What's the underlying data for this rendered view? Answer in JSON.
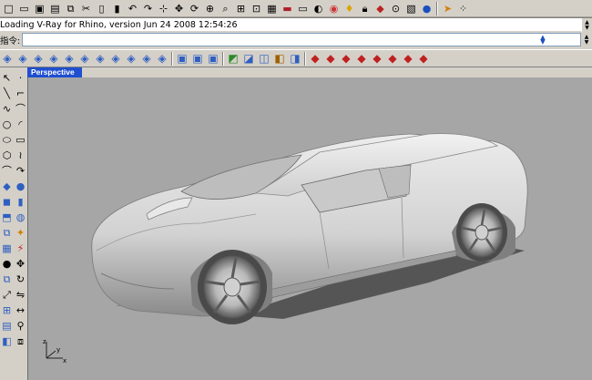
{
  "history": {
    "text": "Loading V-Ray for Rhino, version Jun 24 2008  12:54:26"
  },
  "command": {
    "label": "指令:",
    "value": ""
  },
  "viewport": {
    "title": "Perspective"
  },
  "colors": {
    "viewport_bg": "#a6a6a6",
    "tab_bg": "#1f4fd0",
    "car_body": "#d8d8d8"
  },
  "toolbar_top": [
    "new-icon",
    "open-icon",
    "save-icon",
    "print-icon",
    "copy-icon",
    "cut-icon",
    "paste-icon",
    "undo-icon",
    "redo-icon",
    "select-icon",
    "pan-icon",
    "rotate-icon",
    "zoom-window-icon",
    "zoom-icon",
    "zoom-extents-icon",
    "viewports-icon",
    "grid-icon",
    "car-icon",
    "render-icon",
    "color-icon",
    "light-icon",
    "lock-icon",
    "paint-icon",
    "options-icon",
    "sphere-icon",
    "cursor-icon",
    "help-icon"
  ],
  "toolbar_2": [
    "cube-icon",
    "cube-icon",
    "cube-icon",
    "cube-icon",
    "cube-icon",
    "cube-icon",
    "cube-icon",
    "cube-icon",
    "cube-icon",
    "box-icon",
    "box-icon",
    "box-icon",
    "surface-icon",
    "surface-icon",
    "surface-icon",
    "material-icon",
    "render-icon",
    "render-icon",
    "render-icon",
    "render-icon",
    "render-icon",
    "render-icon",
    "render-icon"
  ],
  "left_tools": [
    "arrow-icon",
    "point-icon",
    "line-icon",
    "polyline-icon",
    "curve-icon",
    "curve-icon",
    "circle-icon",
    "arc-icon",
    "ellipse-icon",
    "rectangle-icon",
    "polygon-icon",
    "freeform-icon",
    "fillet-icon",
    "offset-icon",
    "surface-icon",
    "sphere-icon",
    "box-icon",
    "cylinder-icon",
    "extrude-icon",
    "revolve-icon",
    "boolean-icon",
    "join-icon",
    "mesh-icon",
    "split-icon",
    "trim-icon",
    "move-icon",
    "copy-icon",
    "rotate-icon",
    "scale-icon",
    "mirror-icon",
    "array-icon",
    "dimension-icon",
    "text-icon",
    "analyze-icon",
    "render-icon",
    "layer-icon"
  ]
}
